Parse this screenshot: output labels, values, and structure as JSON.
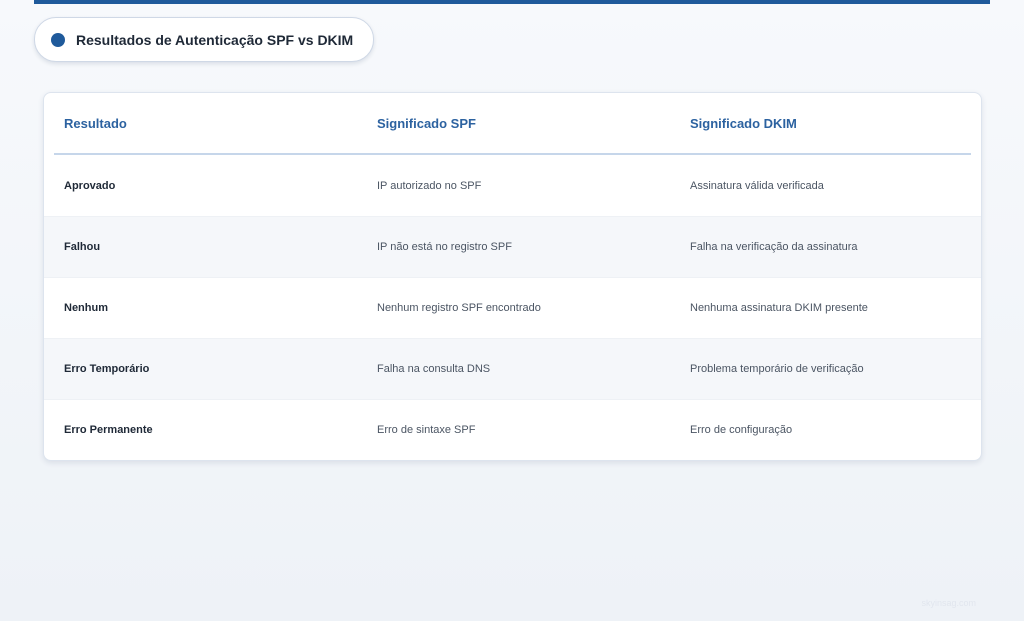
{
  "header": {
    "title": "Resultados de Autenticação SPF vs DKIM",
    "accent_color": "#1f5a9b",
    "header_text_color": "#2c62a0"
  },
  "table": {
    "columns": [
      "Resultado",
      "Significado SPF",
      "Significado DKIM"
    ],
    "rows": [
      [
        "Aprovado",
        "IP autorizado no SPF",
        "Assinatura válida verificada"
      ],
      [
        "Falhou",
        "IP não está no registro SPF",
        "Falha na verificação da assinatura"
      ],
      [
        "Nenhum",
        "Nenhum registro SPF encontrado",
        "Nenhuma assinatura DKIM presente"
      ],
      [
        "Erro Temporário",
        "Falha na consulta DNS",
        "Problema temporário de verificação"
      ],
      [
        "Erro Permanente",
        "Erro de sintaxe SPF",
        "Erro de configuração"
      ]
    ]
  },
  "footer": {
    "watermark": "skyinsag.com"
  }
}
